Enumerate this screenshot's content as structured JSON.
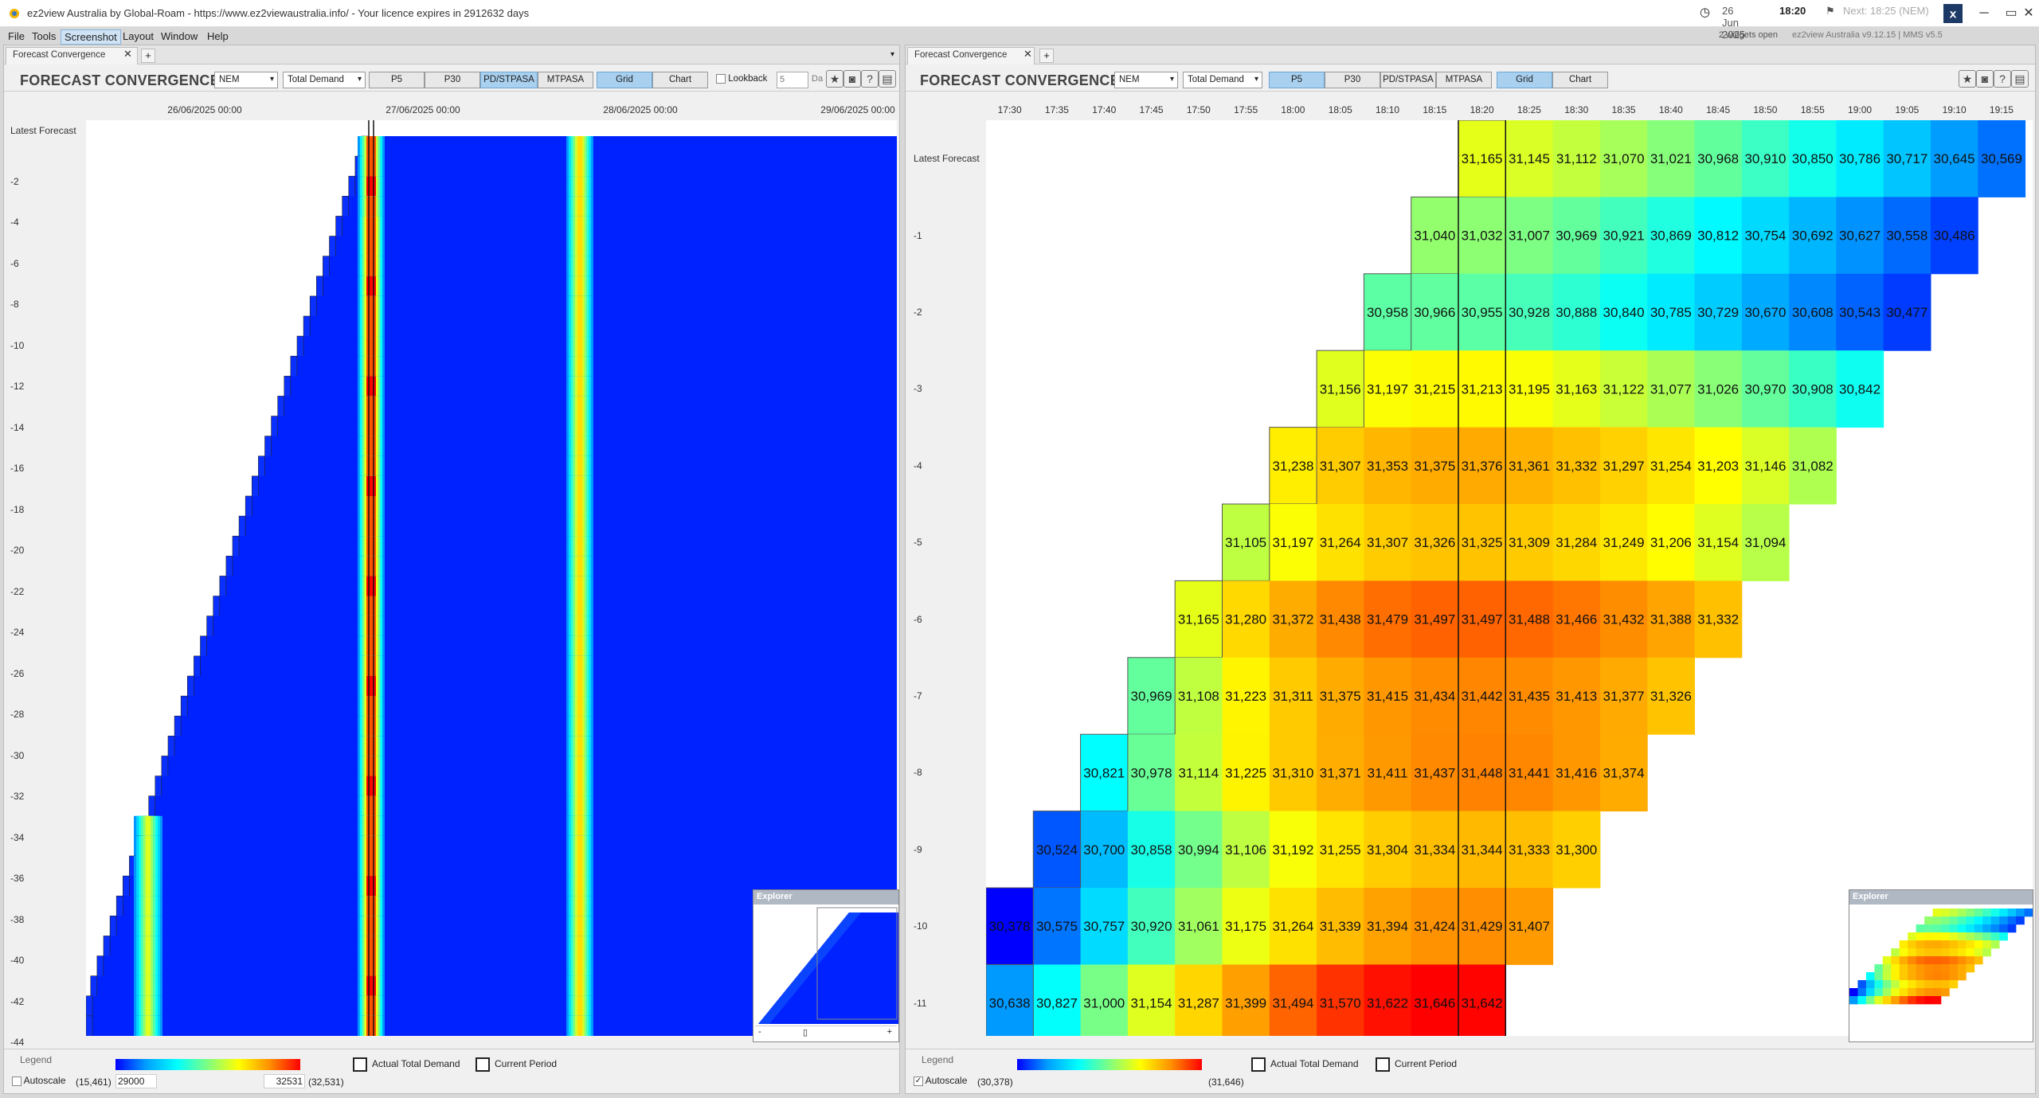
{
  "app": {
    "title": "ez2view Australia by Global-Roam - https://www.ez2viewaustralia.info/ - Your licence expires in 2912632 days",
    "date": "26 Jun 2025",
    "time": "18:20",
    "next": "Next: 18:25 (NEM)",
    "widgets_open": "2 widgets open",
    "version": "ez2view Australia v9.12.15 | MMS v5.5"
  },
  "menu": [
    "File",
    "Tools",
    "Screenshot",
    "Layout",
    "Window",
    "Help"
  ],
  "left": {
    "tab": "Forecast Convergence",
    "title": "FORECAST CONVERGENCE",
    "region": "NEM",
    "measure": "Total Demand",
    "types": [
      "P5",
      "P30",
      "PD/STPASA",
      "MTPASA"
    ],
    "active_type": "PD/STPASA",
    "views": [
      "Grid",
      "Chart"
    ],
    "lookback_label": "Lookback",
    "lookback_value": "5",
    "lookback_unit": "Da",
    "x_labels": [
      "26/06/2025 00:00",
      "27/06/2025 00:00",
      "28/06/2025 00:00",
      "29/06/2025 00:00"
    ],
    "y_labels": [
      "Latest Forecast",
      "-2",
      "-4",
      "-6",
      "-8",
      "-10",
      "-12",
      "-14",
      "-16",
      "-18",
      "-20",
      "-22",
      "-24",
      "-26",
      "-28",
      "-30",
      "-32",
      "-34",
      "-36",
      "-38",
      "-40",
      "-42",
      "-44"
    ],
    "legend": {
      "label": "Legend",
      "autoscale": "Autoscale",
      "min_auto": "(15,461)",
      "min_val": "29000",
      "max_val": "32531",
      "max_auto": "(32,531)",
      "actual": "Actual Total Demand",
      "current": "Current Period"
    },
    "explorer": "Explorer"
  },
  "right": {
    "tab": "Forecast Convergence",
    "title": "FORECAST CONVERGENCE",
    "region": "NEM",
    "measure": "Total Demand",
    "types": [
      "P5",
      "P30",
      "PD/STPASA",
      "MTPASA"
    ],
    "active_type": "P5",
    "views": [
      "Grid",
      "Chart"
    ],
    "legend": {
      "label": "Legend",
      "autoscale": "Autoscale",
      "min_auto": "(30,378)",
      "max_auto": "(31,646)",
      "actual": "Actual Total Demand",
      "current": "Current Period"
    },
    "explorer": "Explorer",
    "colors": {
      "min": 30378,
      "max": 31646
    },
    "grid": {
      "columns": [
        "17:30",
        "17:35",
        "17:40",
        "17:45",
        "17:50",
        "17:55",
        "18:00",
        "18:05",
        "18:10",
        "18:15",
        "18:20",
        "18:25",
        "18:30",
        "18:35",
        "18:40",
        "18:45",
        "18:50",
        "18:55",
        "19:00",
        "19:05",
        "19:10",
        "19:15"
      ],
      "rows": [
        {
          "label": "Latest Forecast",
          "start": 10,
          "values": [
            "31,165",
            "31,145",
            "31,112",
            "31,070",
            "31,021",
            "30,968",
            "30,910",
            "30,850",
            "30,786",
            "30,717",
            "30,645",
            "30,569"
          ]
        },
        {
          "label": "-1",
          "start": 9,
          "values": [
            "31,040",
            "31,032",
            "31,007",
            "30,969",
            "30,921",
            "30,869",
            "30,812",
            "30,754",
            "30,692",
            "30,627",
            "30,558",
            "30,486"
          ]
        },
        {
          "label": "-2",
          "start": 8,
          "values": [
            "30,958",
            "30,966",
            "30,955",
            "30,928",
            "30,888",
            "30,840",
            "30,785",
            "30,729",
            "30,670",
            "30,608",
            "30,543",
            "30,477"
          ]
        },
        {
          "label": "-3",
          "start": 7,
          "values": [
            "31,156",
            "31,197",
            "31,215",
            "31,213",
            "31,195",
            "31,163",
            "31,122",
            "31,077",
            "31,026",
            "30,970",
            "30,908",
            "30,842"
          ]
        },
        {
          "label": "-4",
          "start": 6,
          "values": [
            "31,238",
            "31,307",
            "31,353",
            "31,375",
            "31,376",
            "31,361",
            "31,332",
            "31,297",
            "31,254",
            "31,203",
            "31,146",
            "31,082"
          ]
        },
        {
          "label": "-5",
          "start": 5,
          "values": [
            "31,105",
            "31,197",
            "31,264",
            "31,307",
            "31,326",
            "31,325",
            "31,309",
            "31,284",
            "31,249",
            "31,206",
            "31,154",
            "31,094"
          ]
        },
        {
          "label": "-6",
          "start": 4,
          "values": [
            "31,165",
            "31,280",
            "31,372",
            "31,438",
            "31,479",
            "31,497",
            "31,497",
            "31,488",
            "31,466",
            "31,432",
            "31,388",
            "31,332"
          ]
        },
        {
          "label": "-7",
          "start": 3,
          "values": [
            "30,969",
            "31,108",
            "31,223",
            "31,311",
            "31,375",
            "31,415",
            "31,434",
            "31,442",
            "31,435",
            "31,413",
            "31,377",
            "31,326"
          ]
        },
        {
          "label": "-8",
          "start": 2,
          "values": [
            "30,821",
            "30,978",
            "31,114",
            "31,225",
            "31,310",
            "31,371",
            "31,411",
            "31,437",
            "31,448",
            "31,441",
            "31,416",
            "31,374"
          ]
        },
        {
          "label": "-9",
          "start": 1,
          "values": [
            "30,524",
            "30,700",
            "30,858",
            "30,994",
            "31,106",
            "31,192",
            "31,255",
            "31,304",
            "31,334",
            "31,344",
            "31,333",
            "31,300"
          ]
        },
        {
          "label": "-10",
          "start": 0,
          "values": [
            "30,378",
            "30,575",
            "30,757",
            "30,920",
            "31,061",
            "31,175",
            "31,264",
            "31,339",
            "31,394",
            "31,424",
            "31,429",
            "31,407"
          ]
        },
        {
          "label": "-11",
          "start": 0,
          "values": [
            "30,638",
            "30,827",
            "31,000",
            "31,154",
            "31,287",
            "31,399",
            "31,494",
            "31,570",
            "31,622",
            "31,646",
            "31,642"
          ]
        }
      ]
    }
  }
}
